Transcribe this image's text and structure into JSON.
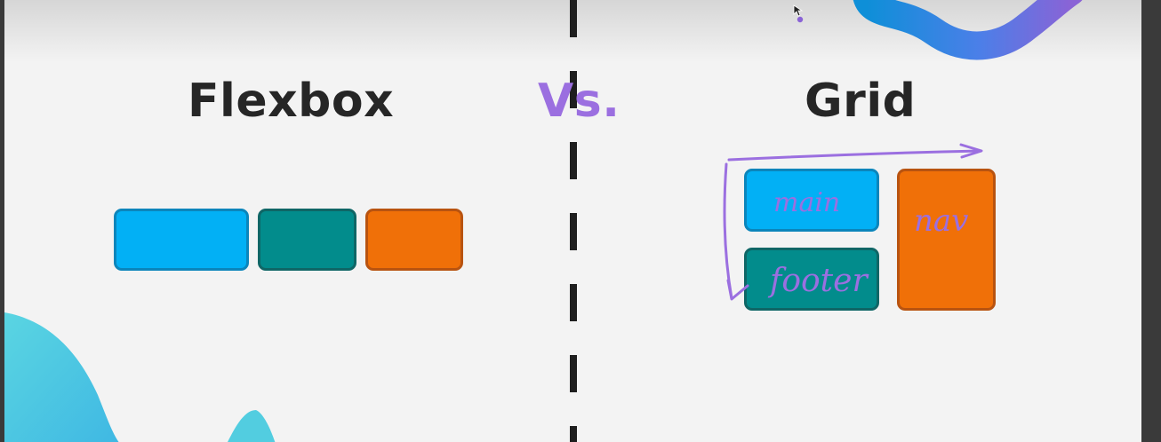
{
  "headings": {
    "flexbox": "Flexbox",
    "versus": "Vs.",
    "grid": "Grid"
  },
  "grid_annotations": {
    "main": "main",
    "footer": "footer",
    "nav": "nav"
  },
  "colors": {
    "blue": "#02b0f5",
    "teal": "#028c8c",
    "orange": "#f07008",
    "annotation": "#9b6fe0",
    "text": "#262626"
  }
}
